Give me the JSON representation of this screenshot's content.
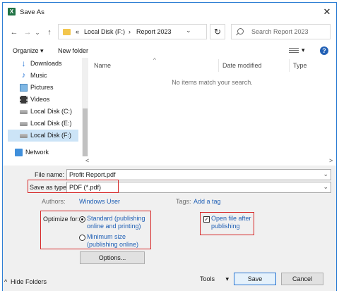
{
  "window": {
    "title": "Save As",
    "logo_letter": "X"
  },
  "address": {
    "breadcrumbs": [
      "«",
      "Local Disk (F:)",
      "›",
      "Report 2023"
    ],
    "search_placeholder": "Search Report 2023"
  },
  "nav_glyphs": {
    "back": "←",
    "forward": "→",
    "recent": "⌄",
    "up": "↑",
    "refresh": "↻",
    "dropdown": "⌄",
    "close": "✕"
  },
  "toolbar": {
    "organize": "Organize ▾",
    "new_folder": "New folder",
    "view_dropdown": "▾",
    "help": "?"
  },
  "sidebar": {
    "items": [
      {
        "label": "Downloads",
        "icon": "download-icon"
      },
      {
        "label": "Music",
        "icon": "music-icon"
      },
      {
        "label": "Pictures",
        "icon": "pictures-icon"
      },
      {
        "label": "Videos",
        "icon": "videos-icon"
      },
      {
        "label": "Local Disk (C:)",
        "icon": "drive-icon"
      },
      {
        "label": "Local Disk (E:)",
        "icon": "drive-icon"
      },
      {
        "label": "Local Disk (F:)",
        "icon": "drive-icon",
        "selected": true
      },
      {
        "label": "Network",
        "icon": "network-icon"
      }
    ]
  },
  "file_list": {
    "columns": [
      "Name",
      "Date modified",
      "Type"
    ],
    "empty_message": "No items match your search."
  },
  "form": {
    "file_name_label": "File name:",
    "file_name_value": "Profit Report.pdf",
    "save_type_label": "Save as type:",
    "save_type_value": "PDF (*.pdf)",
    "authors_label": "Authors:",
    "authors_value": "Windows User",
    "tags_label": "Tags:",
    "tags_value": "Add a tag",
    "optimize_label": "Optimize for:",
    "optimize_options": [
      {
        "line1": "Standard (publishing",
        "line2": "online and printing)",
        "selected": true
      },
      {
        "line1": "Minimum size",
        "line2": "(publishing online)",
        "selected": false
      }
    ],
    "open_after_line1": "Open file after",
    "open_after_line2": "publishing",
    "open_after_checked": true,
    "options_button": "Options..."
  },
  "footer": {
    "hide_folders": "Hide Folders",
    "tools": "Tools",
    "save": "Save",
    "cancel": "Cancel"
  },
  "colors": {
    "accent": "#2f7fd4",
    "highlight_box": "#d62828",
    "link": "#1f5fb5",
    "selected_item": "#cce4f7"
  }
}
